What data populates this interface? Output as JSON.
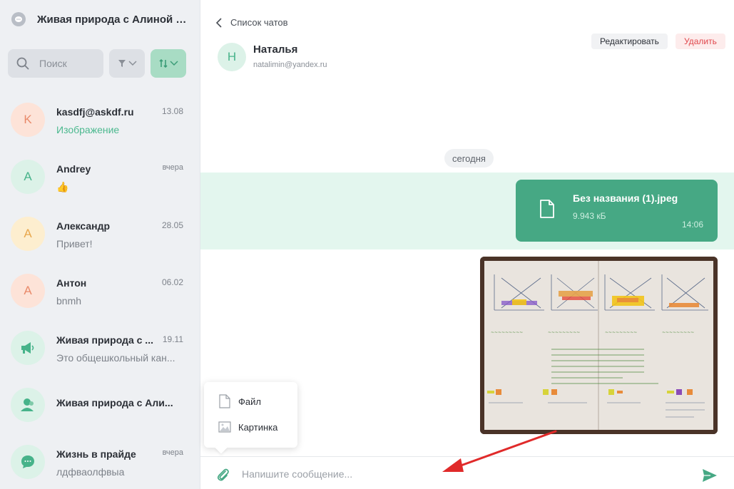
{
  "sidebar": {
    "title": "Живая природа с Алиной С...",
    "search_placeholder": "Поиск",
    "chats": [
      {
        "initial": "K",
        "name": "kasdfj@askdf.ru",
        "time": "13.08",
        "preview": "Изображение",
        "avatar_bg": "#fde3d8",
        "avatar_fg": "#e98a6a"
      },
      {
        "initial": "A",
        "name": "Andrey",
        "time": "вчера",
        "preview": "👍",
        "avatar_bg": "#dcf2e8",
        "avatar_fg": "#47b38a"
      },
      {
        "initial": "A",
        "name": "Александр",
        "time": "28.05",
        "preview": "Привет!",
        "avatar_bg": "#fdeecf",
        "avatar_fg": "#e8a74c"
      },
      {
        "initial": "A",
        "name": "Антон",
        "time": "06.02",
        "preview": "bnmh",
        "avatar_bg": "#fde3d8",
        "avatar_fg": "#e98a6a"
      },
      {
        "initial": "",
        "name": "Живая природа с ...",
        "time": "19.11",
        "preview": "Это общешкольный кан...",
        "avatar_bg": "#dcf2e8",
        "avatar_fg": "#47b38a"
      },
      {
        "initial": "",
        "name": "Живая природа с Али...",
        "time": "",
        "preview": "",
        "avatar_bg": "#dcf2e8",
        "avatar_fg": "#47b38a"
      },
      {
        "initial": "",
        "name": "Жизнь в прайде",
        "time": "вчера",
        "preview": "лдфваолфвыа",
        "avatar_bg": "#dcf2e8",
        "avatar_fg": "#47b38a"
      }
    ]
  },
  "header": {
    "back_label": "Список чатов",
    "contact_initial": "Н",
    "contact_name": "Наталья",
    "contact_email": "natalimin@yandex.ru",
    "edit_label": "Редактировать",
    "delete_label": "Удалить"
  },
  "messages": {
    "date_label": "сегодня",
    "file": {
      "name": "Без названия (1).jpeg",
      "size": "9.943 кБ",
      "time": "14:06"
    }
  },
  "attach_menu": {
    "file_label": "Файл",
    "image_label": "Картинка"
  },
  "composer": {
    "placeholder": "Напишите сообщение..."
  },
  "colors": {
    "accent": "#46a884",
    "accent_light": "#e3f6ee",
    "danger": "#e0474c",
    "annotation_arrow": "#e02a2a"
  }
}
